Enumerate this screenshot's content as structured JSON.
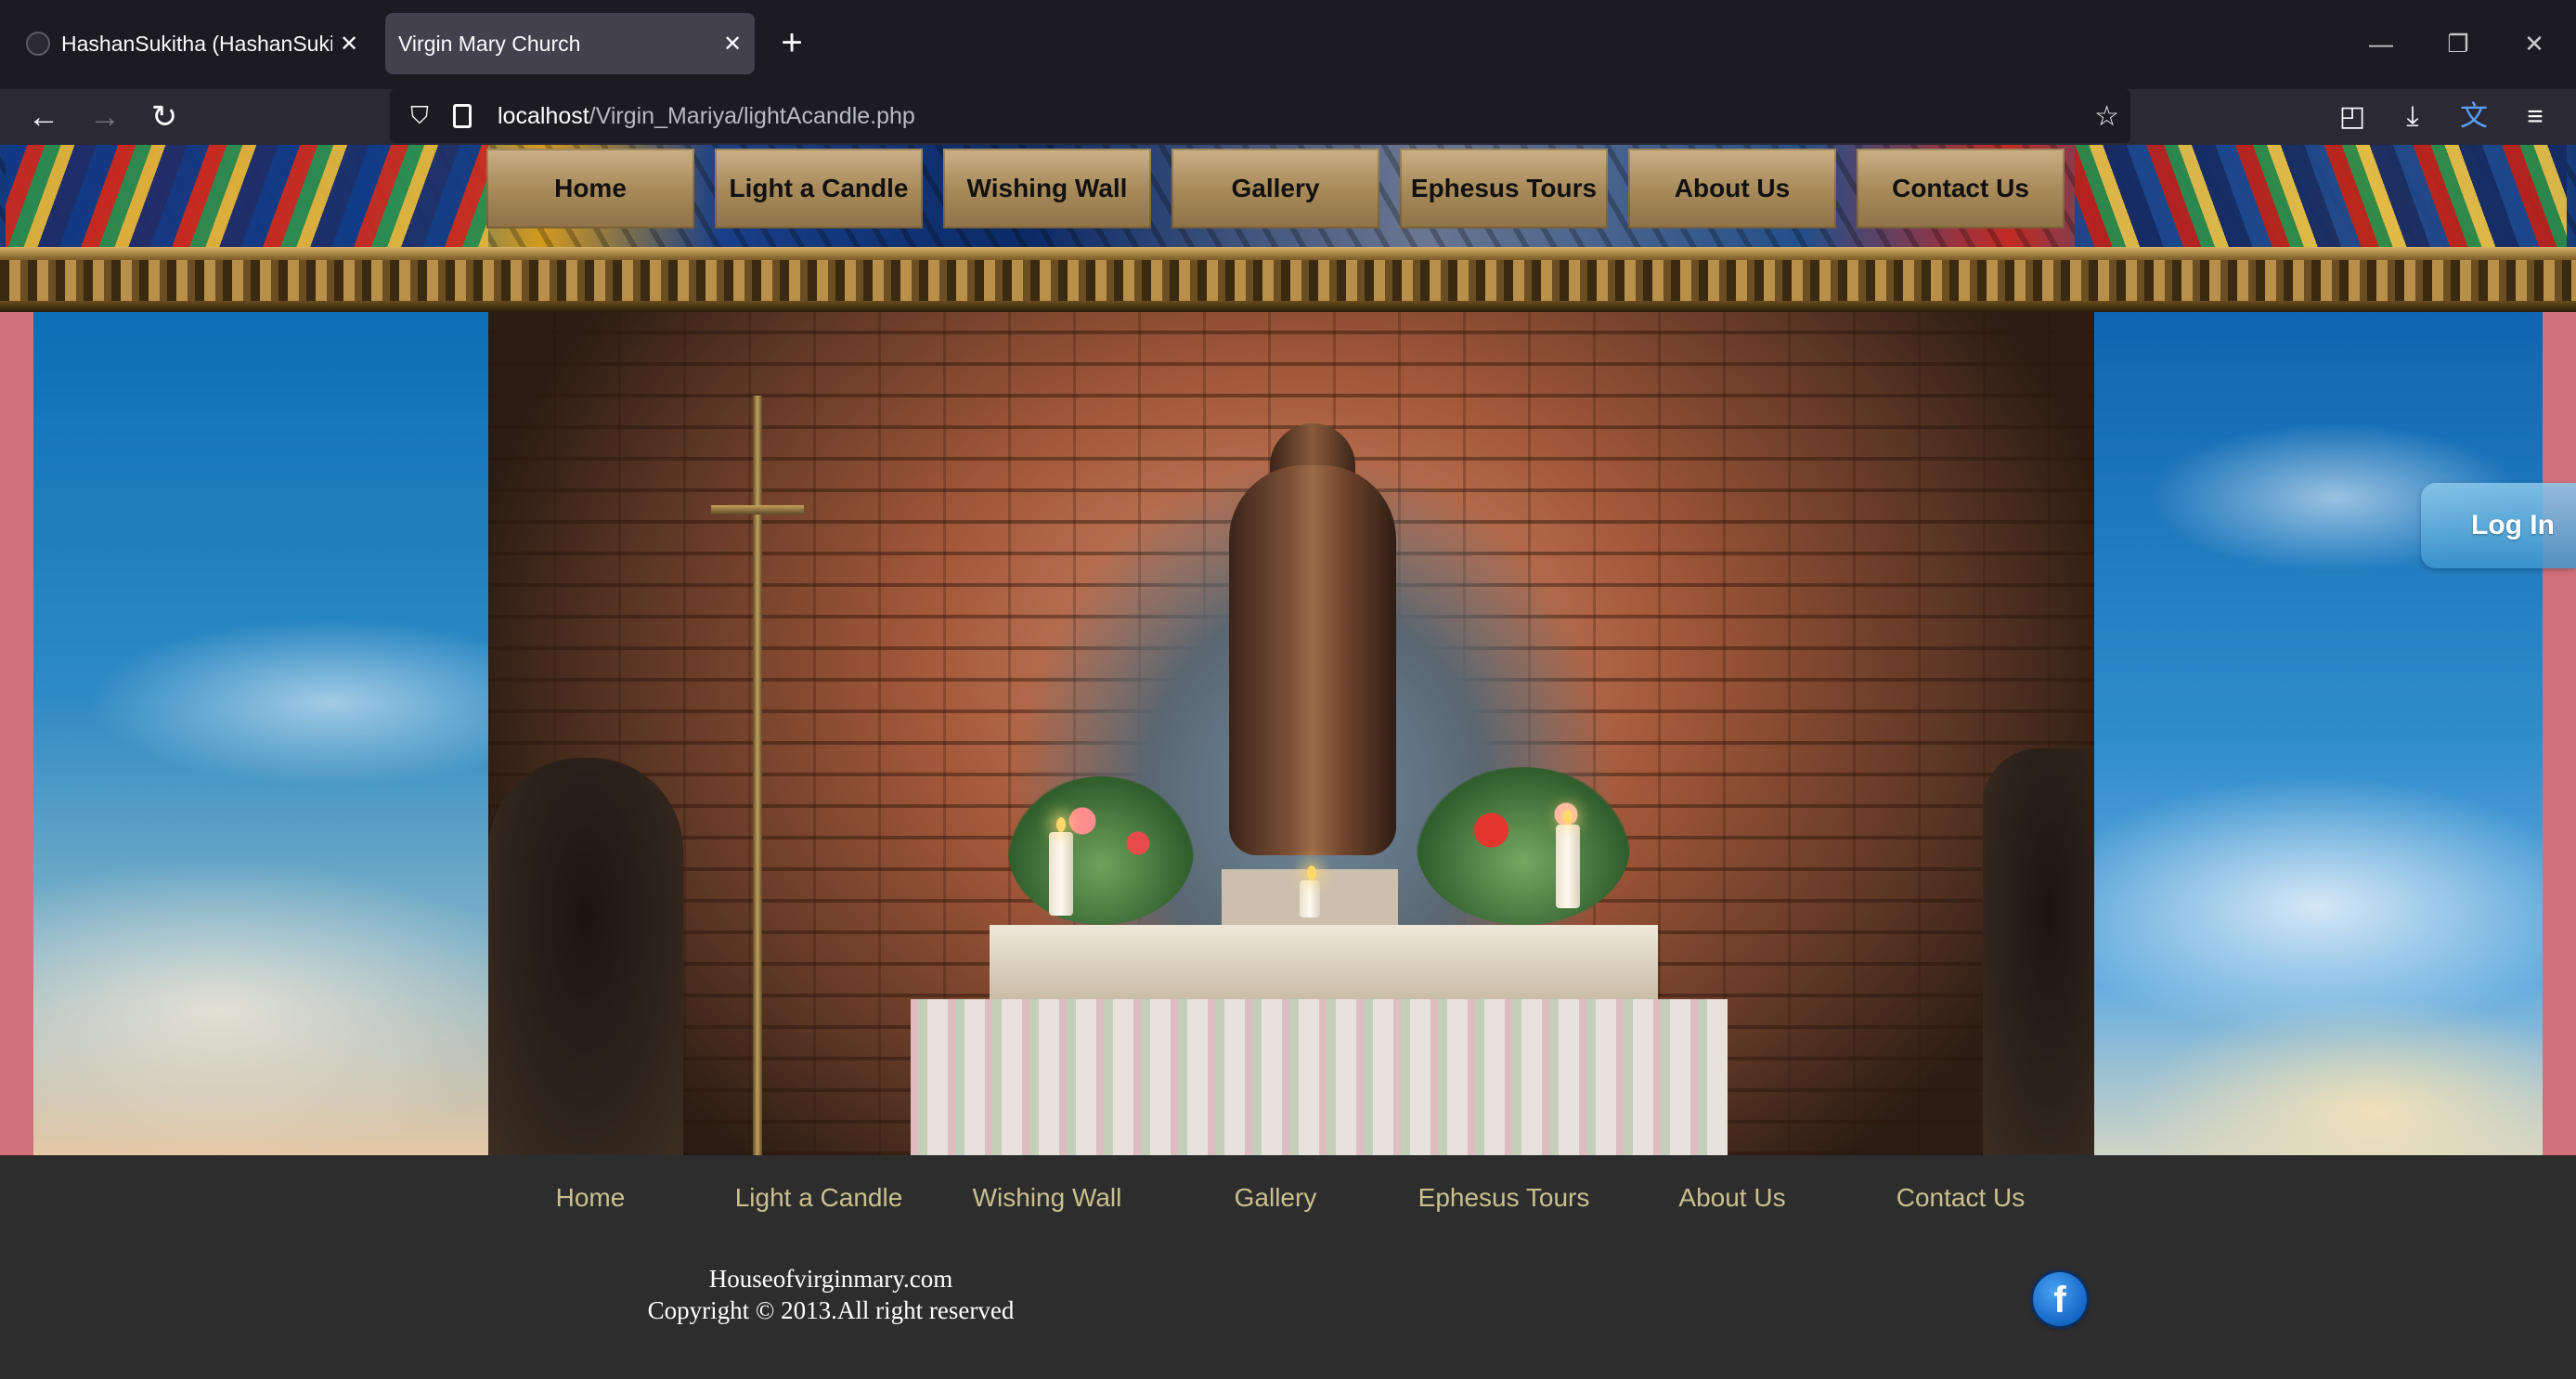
{
  "browser": {
    "tabs": [
      {
        "title": "HashanSukitha (HashanSukitha)",
        "active": false
      },
      {
        "title": "Virgin Mary Church",
        "active": true
      }
    ],
    "tab_close_glyph": "✕",
    "new_tab_glyph": "+",
    "window_controls": {
      "minimize": "—",
      "restore": "❐",
      "close": "✕"
    },
    "nav": {
      "back": "←",
      "forward": "→",
      "reload": "↻"
    },
    "url": {
      "host": "localhost",
      "path": "/Virgin_Mariya/lightAcandle.php"
    },
    "icons": {
      "shield": "⛉",
      "star": "☆",
      "pocket": "◰",
      "download": "⤓",
      "translate": "文",
      "menu": "≡"
    }
  },
  "site": {
    "menu": [
      "Home",
      "Light a Candle",
      "Wishing Wall",
      "Gallery",
      "Ephesus Tours",
      "About Us",
      "Contact Us"
    ],
    "login_label": "Log In",
    "footer_menu": [
      "Home",
      "Light a Candle",
      "Wishing Wall",
      "Gallery",
      "Ephesus Tours",
      "About Us",
      "Contact Us"
    ],
    "footer_site": "Houseofvirginmary.com",
    "footer_copyright": "Copyright © 2013.All right reserved",
    "facebook_glyph": "f"
  },
  "colors": {
    "chrome_tabbar": "#1c1b22",
    "chrome_toolbar": "#2b2a33",
    "menu_tile": "#a98b5b",
    "footer_bg": "#2d2d2d",
    "footer_link": "#c9c08d",
    "side_bar": "#d2717b"
  }
}
